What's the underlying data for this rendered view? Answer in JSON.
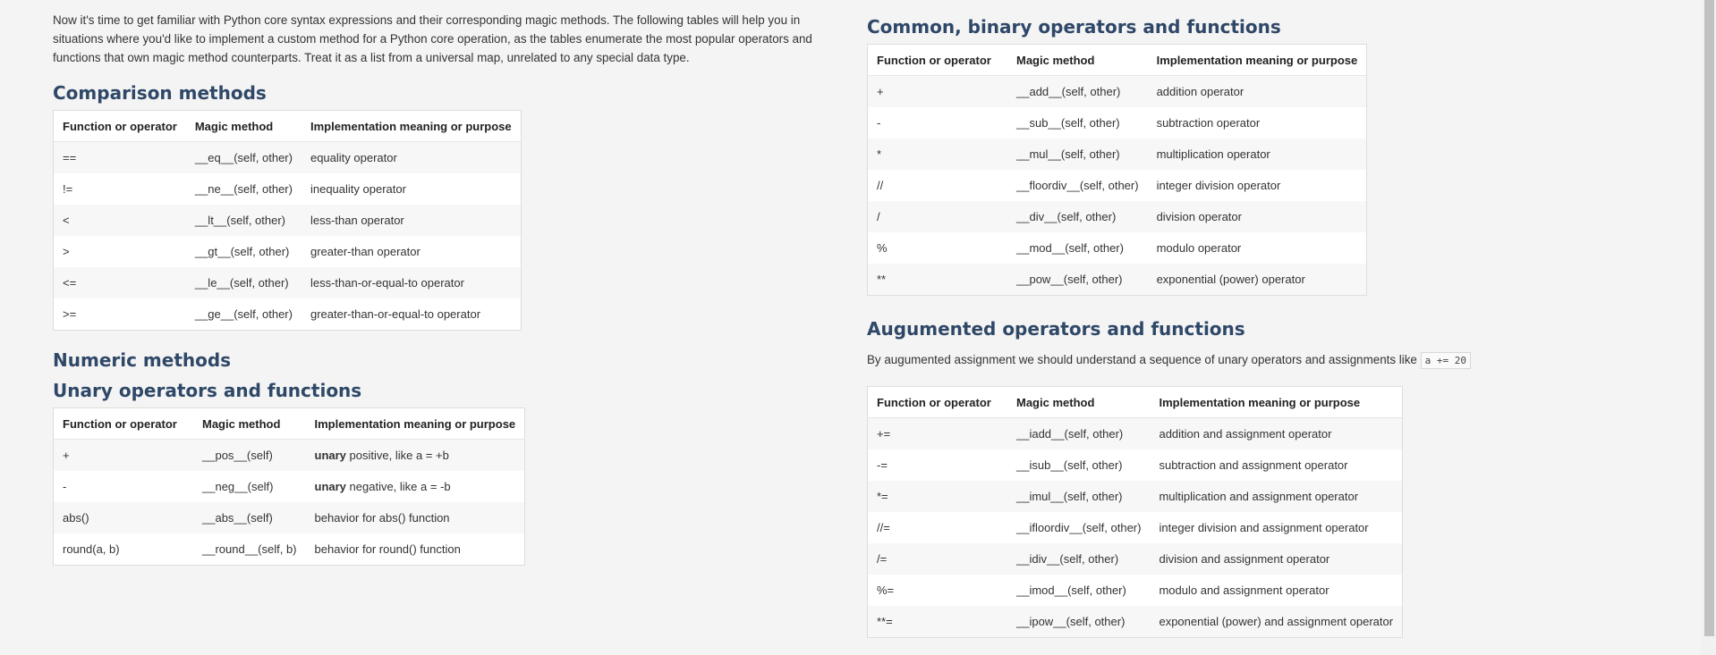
{
  "intro": "Now it's time to get familiar with Python core syntax expressions and their corresponding magic methods. The following tables will help you in situations where you'd like to implement a custom method for a Python core operation, as the tables enumerate the most popular operators and functions that own magic method counterparts. Treat it as a list from a universal map, unrelated to any special data type.",
  "headers": {
    "col1": "Function or operator",
    "col2": "Magic method",
    "col3": "Implementation meaning or purpose"
  },
  "comparison": {
    "title": "Comparison methods",
    "rows": [
      {
        "op": "==",
        "method": "__eq__(self, other)",
        "meaning": "equality operator"
      },
      {
        "op": "!=",
        "method": "__ne__(self, other)",
        "meaning": "inequality operator"
      },
      {
        "op": "<",
        "method": "__lt__(self, other)",
        "meaning": "less-than operator"
      },
      {
        "op": ">",
        "method": "__gt__(self, other)",
        "meaning": "greater-than operator"
      },
      {
        "op": "<=",
        "method": "__le__(self, other)",
        "meaning": "less-than-or-equal-to operator"
      },
      {
        "op": ">=",
        "method": "__ge__(self, other)",
        "meaning": "greater-than-or-equal-to operator"
      }
    ]
  },
  "numeric_title": "Numeric methods",
  "unary": {
    "title": "Unary operators and functions",
    "rows": [
      {
        "op": "+",
        "method": "__pos__(self)",
        "bold": "unary",
        "meaning": " positive, like a = +b"
      },
      {
        "op": "-",
        "method": "__neg__(self)",
        "bold": "unary",
        "meaning": " negative, like a = -b"
      },
      {
        "op": "abs()",
        "method": "__abs__(self)",
        "bold": "",
        "meaning": "behavior for abs() function"
      },
      {
        "op": "round(a, b)",
        "method": "__round__(self, b)",
        "bold": "",
        "meaning": "behavior for round() function"
      }
    ]
  },
  "binary": {
    "title": "Common, binary operators and functions",
    "rows": [
      {
        "op": "+",
        "method": "__add__(self, other)",
        "meaning": "addition operator"
      },
      {
        "op": "-",
        "method": "__sub__(self, other)",
        "meaning": "subtraction operator"
      },
      {
        "op": "*",
        "method": "__mul__(self, other)",
        "meaning": "multiplication operator"
      },
      {
        "op": "//",
        "method": "__floordiv__(self, other)",
        "meaning": "integer division operator"
      },
      {
        "op": "/",
        "method": "__div__(self, other)",
        "meaning": "division operator"
      },
      {
        "op": "%",
        "method": "__mod__(self, other)",
        "meaning": "modulo operator"
      },
      {
        "op": "**",
        "method": "__pow__(self, other)",
        "meaning": "exponential (power) operator"
      }
    ]
  },
  "augmented": {
    "title": "Augumented operators and functions",
    "note": "By augumented assignment we should understand a sequence of unary operators and assignments like ",
    "code": "a += 20",
    "rows": [
      {
        "op": "+=",
        "method": "__iadd__(self, other)",
        "meaning": "addition and assignment operator"
      },
      {
        "op": "-=",
        "method": "__isub__(self, other)",
        "meaning": "subtraction and assignment operator"
      },
      {
        "op": "*=",
        "method": "__imul__(self, other)",
        "meaning": "multiplication and assignment operator"
      },
      {
        "op": "//=",
        "method": "__ifloordiv__(self, other)",
        "meaning": "integer division and assignment operator"
      },
      {
        "op": "/=",
        "method": "__idiv__(self, other)",
        "meaning": "division and assignment operator"
      },
      {
        "op": "%=",
        "method": "__imod__(self, other)",
        "meaning": "modulo and assignment operator"
      },
      {
        "op": "**=",
        "method": "__ipow__(self, other)",
        "meaning": "exponential (power) and assignment operator"
      }
    ]
  }
}
